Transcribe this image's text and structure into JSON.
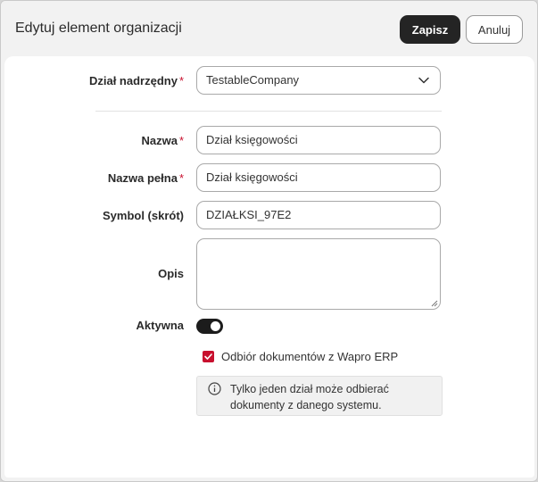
{
  "dialog": {
    "title": "Edytuj element organizacji",
    "save_label": "Zapisz",
    "cancel_label": "Anuluj"
  },
  "form": {
    "parent_department": {
      "label": "Dział nadrzędny",
      "required_mark": "*",
      "value": "TestableCompany"
    },
    "name": {
      "label": "Nazwa",
      "required_mark": "*",
      "value": "Dział księgowości"
    },
    "full_name": {
      "label": "Nazwa pełna",
      "required_mark": "*",
      "value": "Dział księgowości"
    },
    "symbol": {
      "label": "Symbol (skrót)",
      "value": "DZIAŁKSI_97E2"
    },
    "description": {
      "label": "Opis",
      "value": ""
    },
    "active": {
      "label": "Aktywna",
      "checked": true
    },
    "receive_documents": {
      "label": "Odbiór dokumentów z Wapro ERP",
      "checked": true
    },
    "info_text": "Tylko jeden dział może odbierać dokumenty z danego systemu."
  },
  "colors": {
    "accent": "#c8102e",
    "primary_button": "#242424"
  },
  "icons": {
    "select": "chevron-down-icon",
    "info": "info-circle-icon",
    "checkbox": "checkmark-icon"
  }
}
